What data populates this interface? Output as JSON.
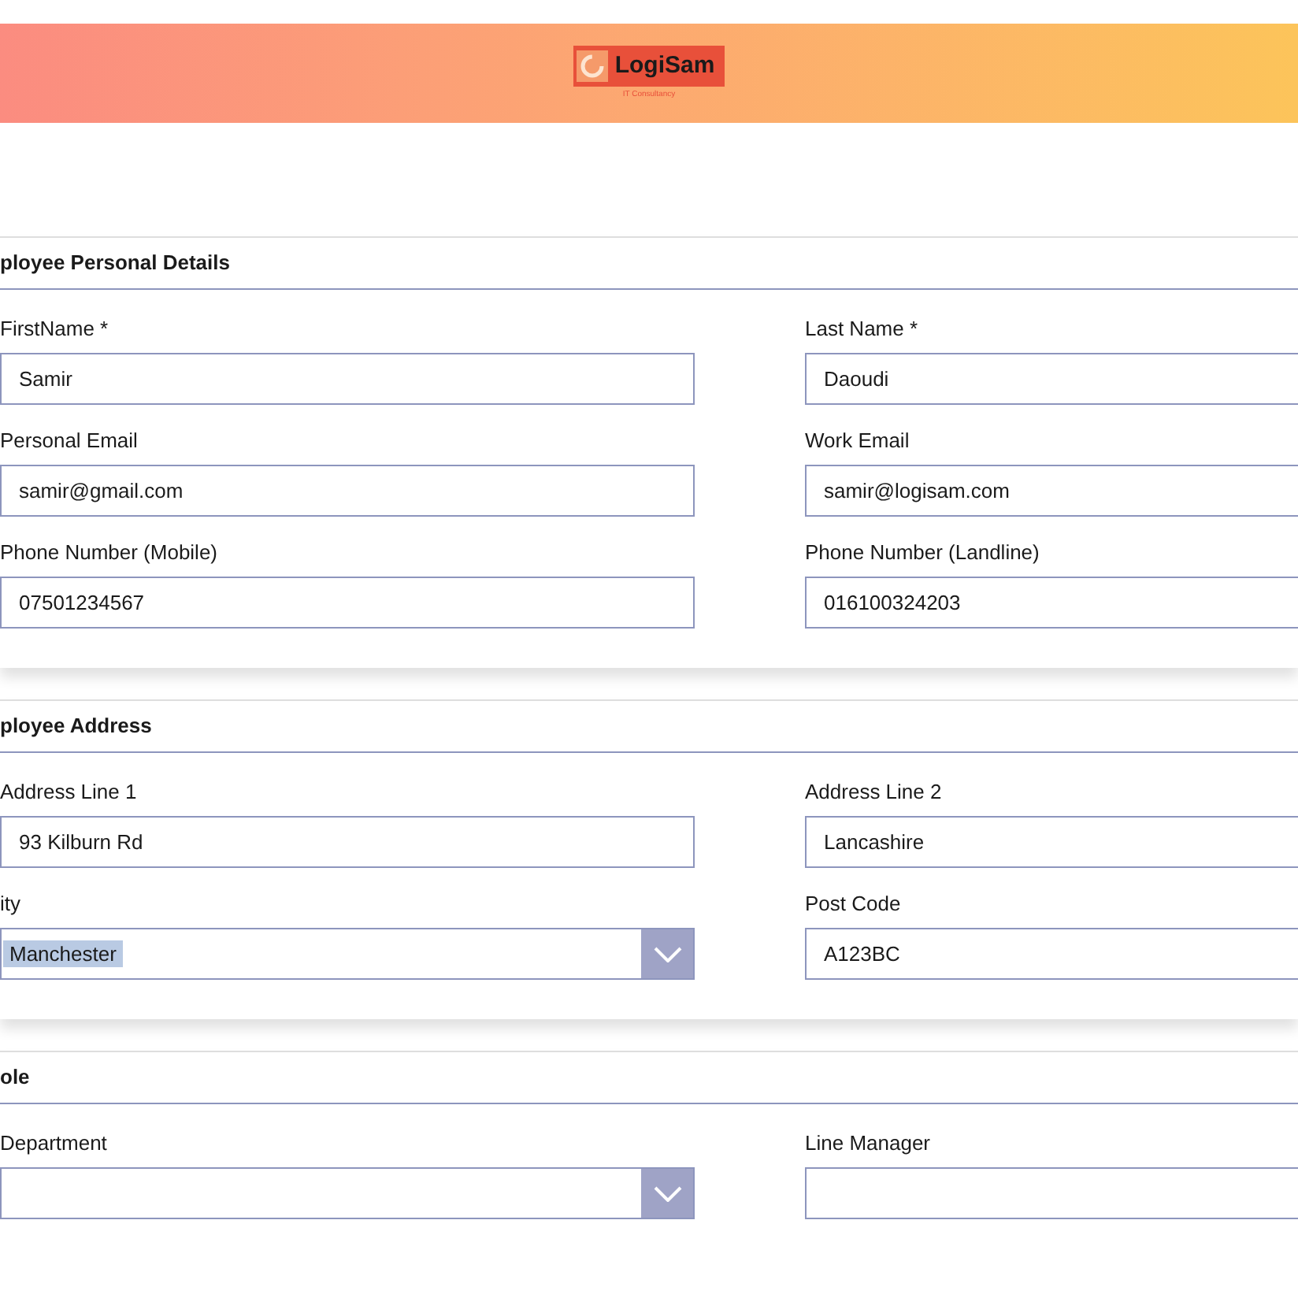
{
  "header": {
    "logo": "LogiSam",
    "tagline": "IT Consultancy"
  },
  "sections": [
    {
      "title": "ployee Personal Details",
      "fields": [
        {
          "label": "FirstName *",
          "value": "Samir",
          "kind": "text"
        },
        {
          "label": "Last Name *",
          "value": "Daoudi",
          "kind": "text"
        },
        {
          "label": "Personal Email",
          "value": "samir@gmail.com",
          "kind": "text"
        },
        {
          "label": "Work Email",
          "value": "samir@logisam.com",
          "kind": "text"
        },
        {
          "label": "Phone Number (Mobile)",
          "value": "07501234567",
          "kind": "text"
        },
        {
          "label": "Phone Number (Landline)",
          "value": "016100324203",
          "kind": "text"
        }
      ]
    },
    {
      "title": "ployee Address",
      "fields": [
        {
          "label": "Address Line 1",
          "value": "93 Kilburn Rd",
          "kind": "text"
        },
        {
          "label": "Address Line 2",
          "value": "Lancashire",
          "kind": "text"
        },
        {
          "label": "ity",
          "value": "Manchester",
          "kind": "dropdown"
        },
        {
          "label": "Post Code",
          "value": "A123BC",
          "kind": "text"
        }
      ]
    },
    {
      "title": "ole",
      "fields": [
        {
          "label": "Department",
          "kind": "dropdown"
        },
        {
          "label": "Line Manager",
          "kind": "text"
        }
      ]
    }
  ]
}
